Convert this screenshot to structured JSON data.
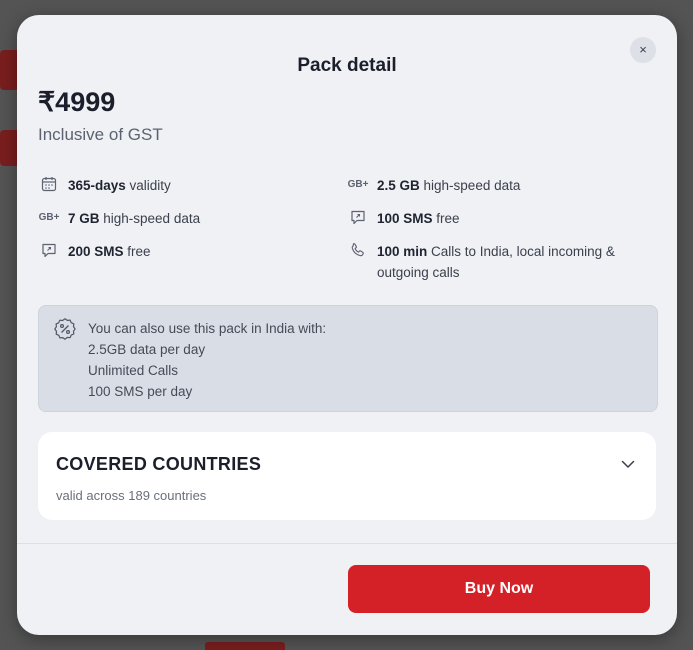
{
  "modal": {
    "title": "Pack detail",
    "close_label": "×",
    "price": "₹4999",
    "price_note": "Inclusive of GST"
  },
  "features": [
    {
      "icon": "calendar-icon",
      "bold": "365-days",
      "text": " validity"
    },
    {
      "icon": "data-gb-icon",
      "icon_text": "GB+",
      "bold": "2.5 GB",
      "text": " high-speed data"
    },
    {
      "icon": "data-gb-icon",
      "icon_text": "GB+",
      "bold": "7 GB",
      "text": " high-speed data"
    },
    {
      "icon": "sms-icon",
      "bold": "100 SMS",
      "text": " free"
    },
    {
      "icon": "sms-icon",
      "bold": "200 SMS",
      "text": " free"
    },
    {
      "icon": "phone-icon",
      "bold": "100 min",
      "text": " Calls to India, local incoming &",
      "text2": "outgoing calls"
    }
  ],
  "india_usage": {
    "lines": [
      "You can also use this pack in India with:",
      "2.5GB data per day",
      "Unlimited Calls",
      "100 SMS per day"
    ]
  },
  "countries": {
    "heading": "COVERED COUNTRIES",
    "subtext": "valid across 189 countries"
  },
  "actions": {
    "buy_label": "Buy Now"
  },
  "colors": {
    "accent": "#d42128",
    "modal_bg": "#eff1f5",
    "info_box": "#d9dee6"
  }
}
